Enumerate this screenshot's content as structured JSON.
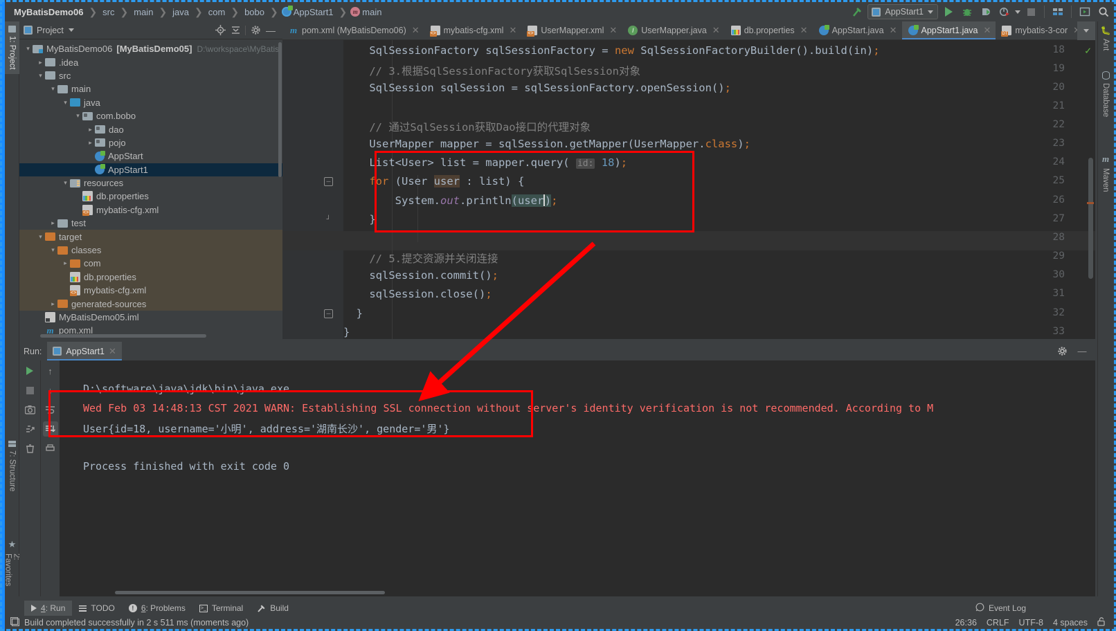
{
  "breadcrumb": {
    "items": [
      {
        "label": "MyBatisDemo06",
        "icon": "",
        "bold": true
      },
      {
        "label": "src",
        "icon": ""
      },
      {
        "label": "main",
        "icon": ""
      },
      {
        "label": "java",
        "icon": ""
      },
      {
        "label": "com",
        "icon": ""
      },
      {
        "label": "bobo",
        "icon": ""
      },
      {
        "label": "AppStart1",
        "icon": "class-icon"
      },
      {
        "label": "main",
        "icon": "method-icon"
      }
    ]
  },
  "toolbar": {
    "build_icon": "hammer-icon",
    "run_config": "AppStart1",
    "run_icon": "run-icon",
    "debug_icon": "debug-icon",
    "run_coverage_icon": "run-with-coverage-icon",
    "profiler_icon": "profiler-icon",
    "stop_icon": "stop-icon",
    "project_structure_icon": "project-structure-icon",
    "updates_icon": "updates-icon",
    "search_icon": "search-everywhere-icon"
  },
  "left_strip": [
    {
      "label": "1: Project",
      "icon": "project-icon",
      "selected": true
    },
    {
      "label": "7: Structure",
      "icon": "structure-icon",
      "selected": false
    },
    {
      "label": "2: Favorites",
      "icon": "favorites-star-icon",
      "selected": false
    }
  ],
  "right_strip": [
    {
      "label": "Ant",
      "icon": "ant-icon"
    },
    {
      "label": "Database",
      "icon": "database-icon"
    },
    {
      "label": "Maven",
      "icon": "maven-icon"
    }
  ],
  "project_panel": {
    "title": "Project",
    "icons": [
      "locate-icon",
      "collapse-all-icon",
      "gear-icon",
      "hide-icon"
    ],
    "tree": [
      {
        "depth": 0,
        "arrow": "down",
        "icon": "module-folder",
        "label": "MyBatisDemo06",
        "bracket": "[MyBatisDemo05]",
        "path": "D:\\workspace\\MyBatis",
        "state": "normal"
      },
      {
        "depth": 1,
        "arrow": "right",
        "icon": "folder-gray",
        "label": ".idea",
        "state": "normal"
      },
      {
        "depth": 1,
        "arrow": "down",
        "icon": "folder-gray",
        "label": "src",
        "state": "normal"
      },
      {
        "depth": 2,
        "arrow": "down",
        "icon": "folder-gray",
        "label": "main",
        "state": "normal"
      },
      {
        "depth": 3,
        "arrow": "down",
        "icon": "folder-blue",
        "label": "java",
        "state": "normal"
      },
      {
        "depth": 4,
        "arrow": "down",
        "icon": "folder-pkg",
        "label": "com.bobo",
        "state": "normal"
      },
      {
        "depth": 5,
        "arrow": "right",
        "icon": "folder-pkg",
        "label": "dao",
        "state": "normal"
      },
      {
        "depth": 5,
        "arrow": "right",
        "icon": "folder-pkg",
        "label": "pojo",
        "state": "normal"
      },
      {
        "depth": 5,
        "arrow": "",
        "icon": "java-class",
        "label": "AppStart",
        "state": "normal"
      },
      {
        "depth": 5,
        "arrow": "",
        "icon": "java-class",
        "label": "AppStart1",
        "state": "selected"
      },
      {
        "depth": 3,
        "arrow": "down",
        "icon": "folder-res",
        "label": "resources",
        "state": "normal"
      },
      {
        "depth": 4,
        "arrow": "",
        "icon": "properties",
        "label": "db.properties",
        "state": "normal"
      },
      {
        "depth": 4,
        "arrow": "",
        "icon": "xml",
        "label": "mybatis-cfg.xml",
        "state": "normal"
      },
      {
        "depth": 2,
        "arrow": "right",
        "icon": "folder-gray",
        "label": "test",
        "state": "normal"
      },
      {
        "depth": 1,
        "arrow": "down",
        "icon": "folder-orange",
        "label": "target",
        "state": "target"
      },
      {
        "depth": 2,
        "arrow": "down",
        "icon": "folder-orange",
        "label": "classes",
        "state": "target"
      },
      {
        "depth": 3,
        "arrow": "right",
        "icon": "folder-orange",
        "label": "com",
        "state": "target"
      },
      {
        "depth": 3,
        "arrow": "",
        "icon": "properties",
        "label": "db.properties",
        "state": "target"
      },
      {
        "depth": 3,
        "arrow": "",
        "icon": "xml",
        "label": "mybatis-cfg.xml",
        "state": "target"
      },
      {
        "depth": 2,
        "arrow": "right",
        "icon": "folder-orange",
        "label": "generated-sources",
        "state": "target"
      },
      {
        "depth": 1,
        "arrow": "",
        "icon": "iml",
        "label": "MyBatisDemo05.iml",
        "state": "normal"
      },
      {
        "depth": 1,
        "arrow": "",
        "icon": "maven",
        "label": "pom.xml",
        "state": "normal"
      }
    ]
  },
  "editor_tabs": [
    {
      "label": "pom.xml (MyBatisDemo06)",
      "icon": "maven-icon",
      "active": false
    },
    {
      "label": "mybatis-cfg.xml",
      "icon": "xml-icon",
      "active": false
    },
    {
      "label": "UserMapper.xml",
      "icon": "xml-icon",
      "active": false
    },
    {
      "label": "UserMapper.java",
      "icon": "interface-icon",
      "active": false
    },
    {
      "label": "db.properties",
      "icon": "properties-icon",
      "active": false
    },
    {
      "label": "AppStart.java",
      "icon": "class-icon",
      "active": false
    },
    {
      "label": "AppStart1.java",
      "icon": "class-icon",
      "active": true
    },
    {
      "label": "mybatis-3-cor",
      "icon": "dtd-icon",
      "active": false
    }
  ],
  "editor": {
    "lines": [
      {
        "n": 18,
        "text": "SqlSessionFactory sqlSessionFactory = new SqlSessionFactoryBuilder().build(in);"
      },
      {
        "n": 19,
        "text": "// 3.根据SqlSessionFactory获取SqlSession对象"
      },
      {
        "n": 20,
        "text": "SqlSession sqlSession = sqlSessionFactory.openSession();"
      },
      {
        "n": 21,
        "text": ""
      },
      {
        "n": 22,
        "text": "// 通过SqlSession获取Dao接口的代理对象"
      },
      {
        "n": 23,
        "text": "UserMapper mapper = sqlSession.getMapper(UserMapper.class);"
      },
      {
        "n": 24,
        "text": "List<User> list = mapper.query( id: 18);"
      },
      {
        "n": 25,
        "text": "for (User user : list) {"
      },
      {
        "n": 26,
        "text": "    System.out.println(user);"
      },
      {
        "n": 27,
        "text": "}"
      },
      {
        "n": 28,
        "text": ""
      },
      {
        "n": 29,
        "text": "// 5.提交资源并关闭连接"
      },
      {
        "n": 30,
        "text": "sqlSession.commit();"
      },
      {
        "n": 31,
        "text": "sqlSession.close();"
      },
      {
        "n": 32,
        "text": "}"
      },
      {
        "n": 33,
        "text": "}"
      }
    ],
    "check_icon": "inspection-ok-icon"
  },
  "run_panel": {
    "label": "Run:",
    "tab": "AppStart1",
    "gear_icon": "settings-icon",
    "minimize_icon": "minimize-icon",
    "buttons": [
      "rerun-icon",
      "stop-icon",
      "screenshot-icon",
      "dump-threads-icon",
      "trash-icon",
      "scroll-up-icon",
      "scroll-down-icon",
      "soft-wrap-icon",
      "scroll-to-end-icon",
      "print-icon"
    ],
    "console": [
      {
        "text": "D:\\software\\java\\jdk\\bin\\java.exe ...",
        "color": "gray"
      },
      {
        "text": "Wed Feb 03 14:48:13 CST 2021 WARN: Establishing SSL connection without server's identity verification is not recommended. According to M",
        "color": "red"
      },
      {
        "text": "User{id=18, username='小明', address='湖南长沙', gender='男'}",
        "color": "gray"
      },
      {
        "text": "",
        "color": "gray"
      },
      {
        "text": "Process finished with exit code 0",
        "color": "gray"
      }
    ]
  },
  "bottom_bar": [
    {
      "label": "4: Run",
      "icon": "run-icon",
      "active": true,
      "mnemonic": "4"
    },
    {
      "label": "TODO",
      "icon": "todo-icon",
      "active": false
    },
    {
      "label": "6: Problems",
      "icon": "problems-icon",
      "active": false,
      "mnemonic": "6"
    },
    {
      "label": "Terminal",
      "icon": "terminal-icon",
      "active": false
    },
    {
      "label": "Build",
      "icon": "build-hammer-icon",
      "active": false
    }
  ],
  "status_bar": {
    "message": "Build completed successfully in 2 s 511 ms (moments ago)",
    "message_icon": "build-status-icon",
    "event_log": "Event Log",
    "event_log_icon": "event-log-icon",
    "caret": "26:36",
    "line_sep": "CRLF",
    "encoding": "UTF-8",
    "indent": "4 spaces",
    "lock_icon": "unlocked-icon"
  },
  "colors": {
    "accent": "#4a88c7",
    "annotation_red": "#ff0000",
    "selection_blue": "#1a8cff",
    "keyword_orange": "#cc7832",
    "number_blue": "#6897bb",
    "comment_gray": "#808080",
    "text": "#a9b7c6",
    "console_error": "#ff6b68"
  }
}
